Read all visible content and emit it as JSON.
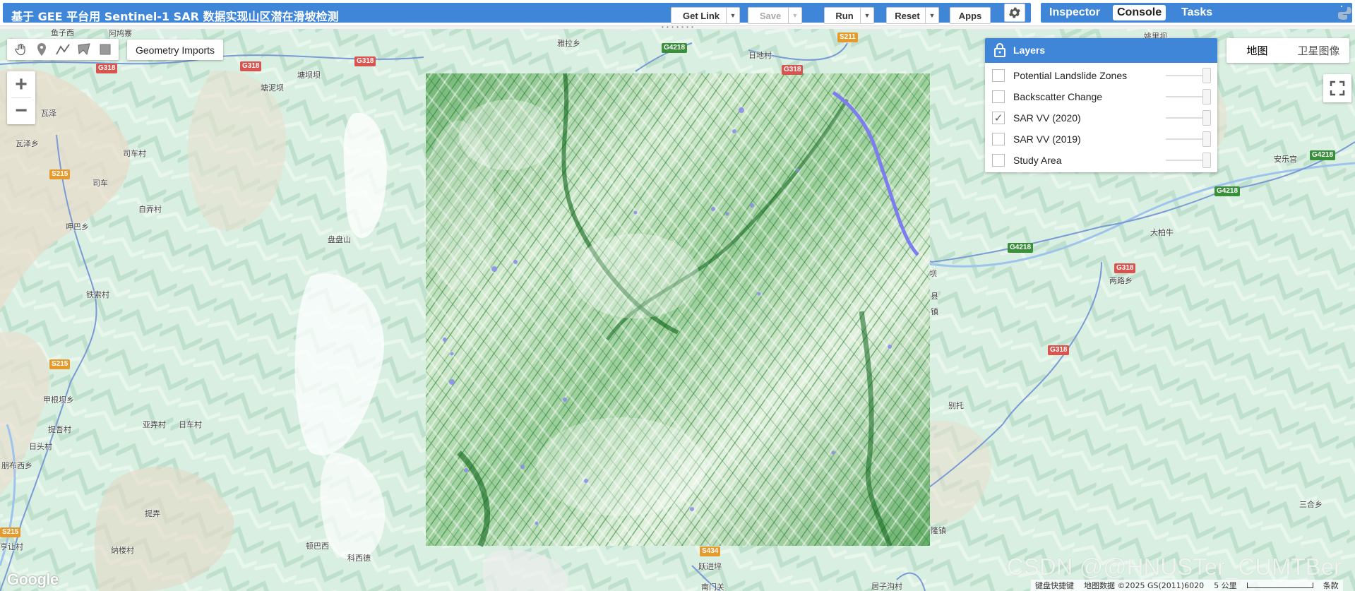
{
  "header": {
    "script_title": "基于 GEE 平台用 Sentinel-1 SAR 数据实现山区潜在滑坡检测",
    "get_link_label": "Get Link",
    "save_label": "Save",
    "run_label": "Run",
    "reset_label": "Reset",
    "apps_label": "Apps"
  },
  "right_panel": {
    "tabs": [
      {
        "label": "Inspector",
        "active": false
      },
      {
        "label": "Console",
        "active": true
      },
      {
        "label": "Tasks",
        "active": false
      }
    ]
  },
  "map": {
    "geometry_imports_label": "Geometry Imports",
    "layers": {
      "title": "Layers",
      "items": [
        {
          "label": "Potential Landslide Zones",
          "checked": false
        },
        {
          "label": "Backscatter Change",
          "checked": false
        },
        {
          "label": "SAR VV (2020)",
          "checked": true
        },
        {
          "label": "SAR VV (2019)",
          "checked": false
        },
        {
          "label": "Study Area",
          "checked": false
        }
      ]
    },
    "map_types": [
      {
        "label": "地图",
        "active": true
      },
      {
        "label": "卫星图像",
        "active": false
      }
    ],
    "place_labels": [
      "鱼子西",
      "阿鸠寨",
      "雅拉乡",
      "日地村",
      "塘泥坝",
      "瓦泽",
      "瓦泽乡",
      "司车村",
      "司车",
      "自弄村",
      "呷巴乡",
      "盘盘山",
      "铁索村",
      "甲根坝乡",
      "提吾村",
      "亚弄村",
      "日车村",
      "日头村",
      "朋布西乡",
      "提弄",
      "纳楼村",
      "顿巴西",
      "科西德",
      "亨让村",
      "南门关",
      "跃进坪",
      "居子沟村",
      "三合乡",
      "别托",
      "两路乡",
      "大柏牛",
      "安乐宫",
      "姚里坝",
      "塘坝坝",
      "隆镇",
      "镇",
      "县",
      "坝"
    ],
    "road_shields": [
      "G318",
      "G318",
      "G318",
      "G318",
      "G318",
      "G318",
      "G4218",
      "G4218",
      "G4218",
      "G4218",
      "S211",
      "S215",
      "S215",
      "S215",
      "S434"
    ],
    "google_logo": "Google",
    "watermark": "CSDN @@HNUSTer_CUMTBer",
    "attribution": {
      "shortcuts": "键盘快捷键",
      "data": "地图数据 ©2025 GS(2011)6020",
      "scale": "5 公里",
      "terms": "条款"
    }
  }
}
